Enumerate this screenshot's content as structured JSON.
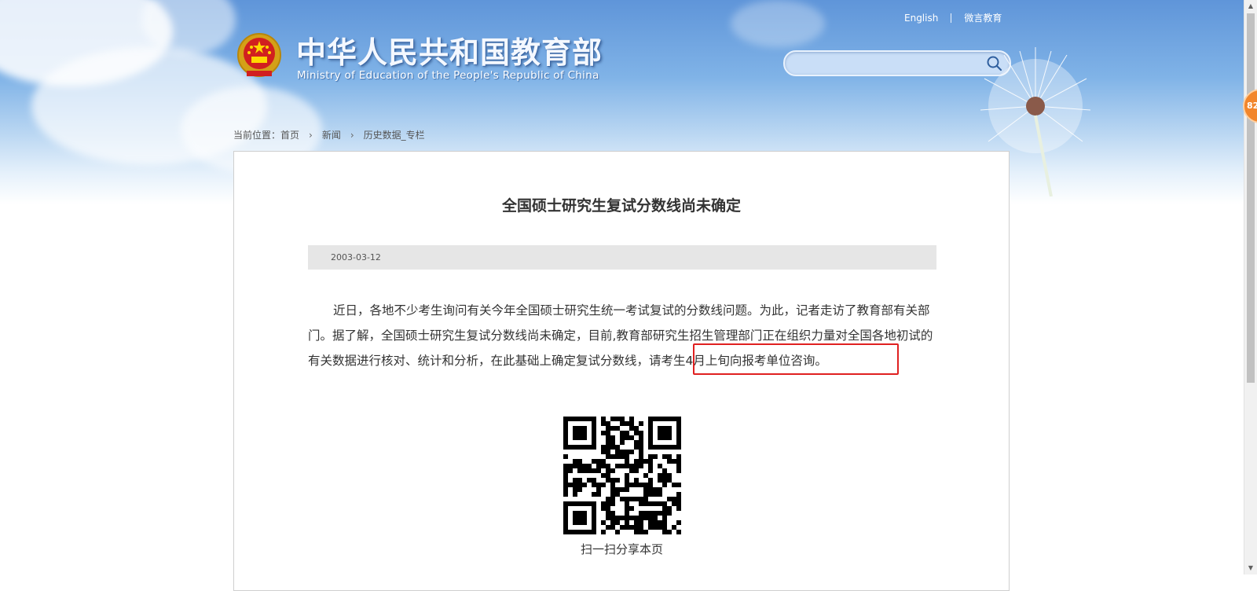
{
  "header": {
    "site_title": "中华人民共和国教育部",
    "site_subtitle": "Ministry of Education of the People's Republic of China",
    "links": {
      "english": "English",
      "weiyan": "微言教育"
    },
    "search": {
      "placeholder": ""
    }
  },
  "breadcrumb": {
    "prefix": "当前位置：",
    "items": [
      "首页",
      "新闻",
      "历史数据_专栏"
    ],
    "separator": "›"
  },
  "article": {
    "title": "全国硕士研究生复试分数线尚未确定",
    "date": "2003-03-12",
    "body": "近日，各地不少考生询问有关今年全国硕士研究生统一考试复试的分数线问题。为此，记者走访了教育部有关部门。据了解，全国硕士研究生复试分数线尚未确定，目前,教育部研究生招生管理部门正在组织力量对全国各地初试的有关数据进行核对、统计和分析，在此基础上确定复试分数线，请考生4月上旬向报考单位咨询。",
    "highlight_color": "#e02020"
  },
  "qr": {
    "caption": "扫一扫分享本页"
  },
  "float_badge": {
    "text": "82"
  },
  "colors": {
    "banner_top": "#5f95d9",
    "datebar": "#e6e6e6",
    "badge": "#f2862c"
  }
}
